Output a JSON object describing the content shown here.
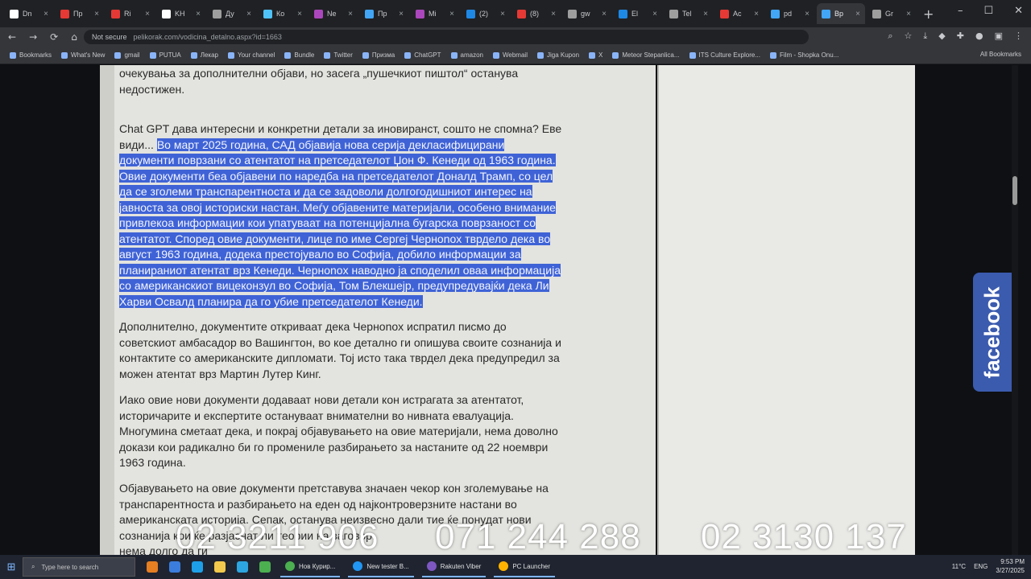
{
  "browser": {
    "tabs": [
      {
        "label": "Dn",
        "color": "#ffffff"
      },
      {
        "label": "Пр",
        "color": "#e53935"
      },
      {
        "label": "Ri",
        "color": "#e53935"
      },
      {
        "label": "KH",
        "color": "#ffffff"
      },
      {
        "label": "Ду",
        "color": "#9e9e9e"
      },
      {
        "label": "Ко",
        "color": "#4fc3f7"
      },
      {
        "label": "Ne",
        "color": "#ab47bc"
      },
      {
        "label": "Пр",
        "color": "#42a5f5"
      },
      {
        "label": "Mi",
        "color": "#ab47bc"
      },
      {
        "label": "(2)",
        "color": "#1e88e5"
      },
      {
        "label": "(8)",
        "color": "#e53935"
      },
      {
        "label": "gw",
        "color": "#9e9e9e"
      },
      {
        "label": "El",
        "color": "#1e88e5"
      },
      {
        "label": "Tel",
        "color": "#9e9e9e"
      },
      {
        "label": "Ac",
        "color": "#e53935"
      },
      {
        "label": "pd",
        "color": "#42a5f5"
      },
      {
        "label": "Вр",
        "color": "#42a5f5",
        "active": true
      },
      {
        "label": "Gr",
        "color": "#9e9e9e"
      }
    ],
    "new_tab": "+",
    "window_controls": {
      "min": "–",
      "max": "☐",
      "close": "✕"
    },
    "nav": {
      "back": "←",
      "forward": "→",
      "reload": "⟳",
      "home": "⌂"
    },
    "omnibox": {
      "security": "Not secure",
      "url": "pelikorak.com/vodicina_detalno.aspx?id=1663"
    },
    "bookmarks": [
      "Bookmarks",
      "What's New",
      "gmail",
      "PUTUA",
      "Лекар",
      "Your channel",
      "Bundle",
      "Twitter",
      "Призма",
      "ChatGPT",
      "amazon",
      "Webmail",
      "Jiga Kupon",
      "X",
      "Meteor Stepanlica...",
      "ITS Culture Explore...",
      "Film - Shopka Onu..."
    ],
    "all_bookmarks": "All Bookmarks"
  },
  "article": {
    "para_top_lines": [
      "очекувања за дополнителни објави, но засега „пушечкиот пиштол“ останува",
      "недостижен."
    ],
    "para_gpt_line1": "Chat GPT дава интересни и конкретни детали за иновиранст, сошто не спомна? Еве",
    "para_gpt_intro": "види...",
    "highlight_lines": [
      "Во март 2025 година, САД објавија нова серија декласифицирани",
      "документи поврзани со атентатот на претседателот Џон Ф. Кенеди од 1963 година.",
      "Овие документи беа објавени по наредба на претседателот Доналд Трамп, со цел",
      "да се зголеми транспарентноста и да се задоволи долгогодишниот интерес на",
      "јавноста за овој историски настан. Меѓу објавените материјали, особено внимание",
      "привлекоа информации кои упатуваат на потенцијална бугарска поврзаност со",
      "атентатот. Според овие документи, лице по име Сергеј Черноnox тврдело дека во",
      "август 1963 година, додека престојувало во Софија, добило информации за",
      "планираниот атентат врз Кенеди. Черноnox наводно ја споделил оваа информација",
      "со американскиот вицеконзул во Софија, Том Блекшејр, предупредувајќи дека Ли",
      "Харви Освалд планира да го убие претседателот Кенеди."
    ],
    "para3_lines": [
      "Дополнително, документите откриваат дека Черноnox испратил писмо до",
      "советскиот амбасадор во Вашингтон, во кое детално ги опишува своите сознанија и",
      "контактите со американските дипломати. Тој исто така тврдел дека предупредил за",
      "можен атентат врз Мартин Лутер Кинг."
    ],
    "para4_lines": [
      "Иако овие нови документи додаваат нови детали кон истрагата за атентатот,",
      "историчарите и експертите остануваат внимателни во нивната евалуација.",
      "Многумина сметаат дека, и покрај објавувањето на овие материјали, нема доволно",
      "докази кои радикално би го промениле разбирањето за настаните од 22 ноември",
      "1963 година."
    ],
    "para5_lines": [
      "Објавувањето на овие документи претставува значаен чекор кон зголемување на",
      "транспарентноста и разбирањето на еден од најконтроверзните настани во",
      "американската историја. Сепак, останува неизвесно дали тие ќе понудат нови",
      "сознанија кои ќе разјаснат ли теории на заговор.",
      "нема долго да ги"
    ]
  },
  "facebook_tab": "facebook",
  "phones": [
    "02 3211 906",
    "071 244 288",
    "02 3130 137"
  ],
  "taskbar": {
    "start": "⊞",
    "search_placeholder": "Type here to search",
    "apps": [
      {
        "label": "Нов Курир...",
        "color": "#4caf50"
      },
      {
        "label": "New tester B...",
        "color": "#2196f3"
      },
      {
        "label": "Rakuten Viber",
        "color": "#7e57c2"
      },
      {
        "label": "PC Launcher",
        "color": "#ffb300"
      }
    ],
    "weather": "11°C",
    "lang": "ENG",
    "time": "9:53 PM",
    "date": "3/27/2025"
  }
}
